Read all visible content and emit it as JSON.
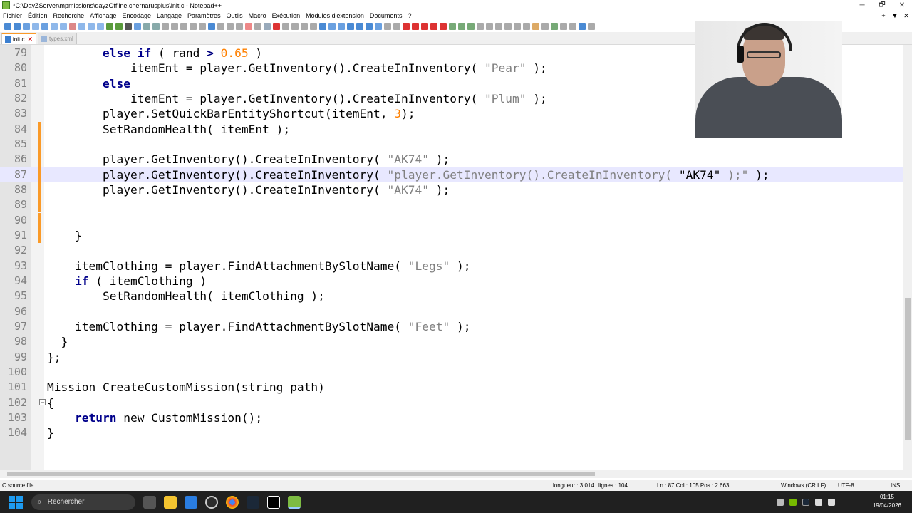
{
  "window": {
    "title": "*C:\\DayZServer\\mpmissions\\dayzOffline.chernarusplus\\init.c - Notepad++",
    "minimize": "─",
    "maximize": "🗗",
    "close": "✕"
  },
  "menu": [
    "Fichier",
    "Édition",
    "Recherche",
    "Affichage",
    "Encodage",
    "Langage",
    "Paramètres",
    "Outils",
    "Macro",
    "Exécution",
    "Modules d'extension",
    "Documents",
    "?"
  ],
  "menu_right": [
    "+",
    "▼",
    "✕"
  ],
  "tabs": [
    {
      "label": "init.c",
      "active": true
    },
    {
      "label": "types.xml",
      "active": false
    }
  ],
  "editor": {
    "lines": [
      {
        "n": "79",
        "html": "        <span class='kw'>else</span> <span class='kw'>if</span> ( rand <span class='op'>&gt;</span> <span class='num'>0.65</span> )"
      },
      {
        "n": "80",
        "html": "            itemEnt = player.GetInventory().CreateInInventory( <span class='str'>\"Pear\"</span> );"
      },
      {
        "n": "81",
        "html": "        <span class='kw'>else</span>"
      },
      {
        "n": "82",
        "html": "            itemEnt = player.GetInventory().CreateInInventory( <span class='str'>\"Plum\"</span> );"
      },
      {
        "n": "83",
        "html": "        player.SetQuickBarEntityShortcut(itemEnt, <span class='num'>3</span>);"
      },
      {
        "n": "84",
        "html": "        SetRandomHealth( itemEnt );"
      },
      {
        "n": "85",
        "html": ""
      },
      {
        "n": "86",
        "html": "        player.GetInventory().CreateInInventory( <span class='str'>\"AK74\"</span> );"
      },
      {
        "n": "87",
        "html": "        player.GetInventory().CreateInInventory( <span class='str'>\"player.GetInventory().CreateInInventory( </span>\"AK74\"<span class='str'> );\"</span> );"
      },
      {
        "n": "88",
        "html": "        player.GetInventory().CreateInInventory( <span class='str'>\"AK74\"</span> );"
      },
      {
        "n": "89",
        "html": ""
      },
      {
        "n": "90",
        "html": ""
      },
      {
        "n": "91",
        "html": "    }"
      },
      {
        "n": "92",
        "html": ""
      },
      {
        "n": "93",
        "html": "    itemClothing = player.FindAttachmentBySlotName( <span class='str'>\"Legs\"</span> );"
      },
      {
        "n": "94",
        "html": "    <span class='kw'>if</span> ( itemClothing )"
      },
      {
        "n": "95",
        "html": "        SetRandomHealth( itemClothing );"
      },
      {
        "n": "96",
        "html": ""
      },
      {
        "n": "97",
        "html": "    itemClothing = player.FindAttachmentBySlotName( <span class='str'>\"Feet\"</span> );"
      },
      {
        "n": "98",
        "html": "  }"
      },
      {
        "n": "99",
        "html": "};"
      },
      {
        "n": "100",
        "html": ""
      },
      {
        "n": "101",
        "html": "Mission CreateCustomMission(string path)"
      },
      {
        "n": "102",
        "html": "{"
      },
      {
        "n": "103",
        "html": "    <span class='kw'>return</span> new CustomMission();"
      },
      {
        "n": "104",
        "html": "}"
      }
    ],
    "current_line": "87",
    "changed_lines": [
      "84",
      "85",
      "86",
      "87",
      "88",
      "89",
      "90",
      "91"
    ]
  },
  "status": {
    "filetype": "C source file",
    "length": "longueur : 3 014",
    "lines": "lignes : 104",
    "position": "Ln : 87    Col : 105    Pos : 2 663",
    "eol": "Windows (CR LF)",
    "encoding": "UTF-8",
    "mode": "INS"
  },
  "taskbar": {
    "search_placeholder": "Rechercher",
    "time": "01:15",
    "date": "19/04/2026"
  }
}
